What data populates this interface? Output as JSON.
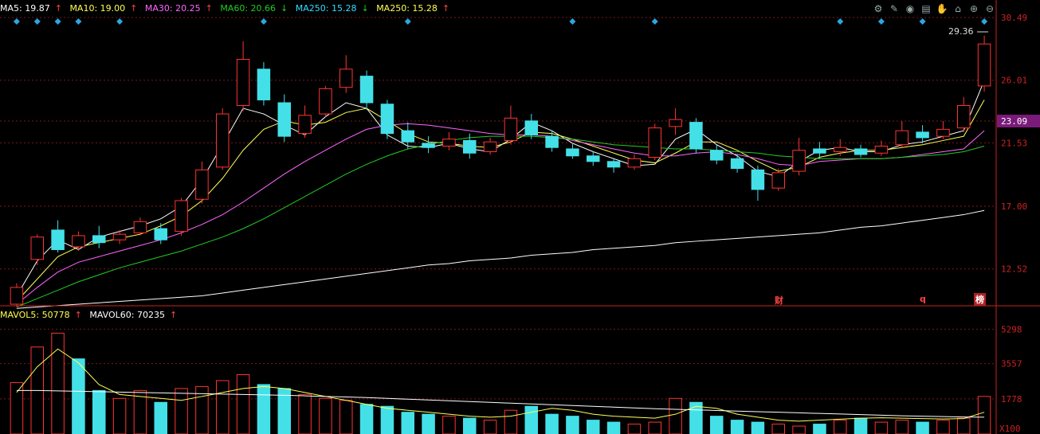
{
  "ma_legend": {
    "ma5": {
      "label": "MA5: 19.87",
      "arrow": "↑",
      "color": "#ffffff"
    },
    "ma10": {
      "label": "MA10: 19.00",
      "arrow": "↑",
      "color": "#ffff55"
    },
    "ma30": {
      "label": "MA30: 20.25",
      "arrow": "↑",
      "color": "#ff66ff"
    },
    "ma60": {
      "label": "MA60: 20.66",
      "arrow": "↓",
      "color": "#22cc22"
    },
    "ma250a": {
      "label": "MA250: 15.28",
      "arrow": "↓",
      "color": "#33ddff"
    },
    "ma250b": {
      "label": "MA250: 15.28",
      "arrow": "↑",
      "color": "#ffff55"
    }
  },
  "vol_legend": {
    "mavol5": {
      "label": "MAVOL5: 50778",
      "arrow": "↑",
      "color": "#ffff55"
    },
    "mavol60": {
      "label": "MAVOL60: 70235",
      "arrow": "↑",
      "color": "#ffffff"
    }
  },
  "toolbar": [
    "gear-icon",
    "draw-icon",
    "eye-icon",
    "print-icon",
    "hand-icon",
    "lock-icon",
    "zoom-in-icon",
    "zoom-out-icon"
  ],
  "price_axis_labels": [
    "30.49",
    "26.01",
    "23.09",
    "21.53",
    "17.00",
    "12.52"
  ],
  "volume_axis_labels": [
    "5298",
    "3557",
    "1778",
    "X100"
  ],
  "highlight_price": "23.09",
  "last_price_tag": "29.36",
  "markers": {
    "cai": "财",
    "q": "q",
    "bang": "榜"
  },
  "colors": {
    "up": "#ff3333",
    "down": "#44e0e8",
    "grid": "#7a1a1a",
    "axis": "#cc2222"
  },
  "chart_data": [
    {
      "type": "candlestick",
      "title": "",
      "ylim": [
        10.0,
        30.49
      ],
      "y_ticks": [
        30.49,
        26.01,
        23.09,
        21.53,
        17.0,
        12.52
      ],
      "series": [
        {
          "name": "MA5",
          "values": [
            10.6,
            13.1,
            14.6,
            13.9,
            14.8,
            15.2,
            15.6,
            16.1,
            17.0,
            18.9,
            21.4,
            24.0,
            23.6,
            22.8,
            22.1,
            23.4,
            24.4,
            24.0,
            22.1,
            21.3,
            21.2,
            21.5,
            21.1,
            20.9,
            21.8,
            23.0,
            22.4,
            21.5,
            20.9,
            20.4,
            19.9,
            20.0,
            21.8,
            22.5,
            21.4,
            20.6,
            19.5,
            19.1,
            20.2,
            21.0,
            21.2,
            20.9,
            20.9,
            21.4,
            21.6,
            22.0,
            22.4,
            26.0
          ]
        },
        {
          "name": "MA10",
          "values": [
            10.2,
            11.8,
            13.4,
            14.1,
            14.4,
            14.7,
            15.0,
            15.6,
            16.3,
            17.4,
            19.0,
            21.0,
            22.5,
            23.1,
            22.8,
            23.0,
            23.7,
            24.0,
            23.1,
            22.2,
            21.6,
            21.5,
            21.3,
            21.2,
            21.6,
            22.3,
            22.2,
            21.8,
            21.3,
            20.8,
            20.3,
            20.1,
            20.8,
            21.6,
            21.6,
            21.0,
            20.2,
            19.5,
            19.8,
            20.5,
            20.8,
            21.0,
            21.0,
            21.2,
            21.4,
            21.7,
            22.0,
            24.6
          ]
        },
        {
          "name": "MA30",
          "values": [
            10.0,
            11.2,
            12.3,
            13.0,
            13.4,
            13.8,
            14.2,
            14.6,
            15.1,
            15.7,
            16.4,
            17.3,
            18.3,
            19.3,
            20.2,
            21.0,
            21.8,
            22.5,
            22.8,
            22.9,
            22.8,
            22.6,
            22.4,
            22.2,
            22.1,
            22.1,
            22.0,
            21.7,
            21.4,
            21.1,
            20.8,
            20.6,
            20.6,
            20.8,
            20.9,
            20.7,
            20.4,
            20.0,
            19.9,
            20.2,
            20.3,
            20.4,
            20.4,
            20.5,
            20.7,
            20.9,
            21.1,
            22.4
          ]
        },
        {
          "name": "MA60",
          "values": [
            9.8,
            10.4,
            11.0,
            11.6,
            12.1,
            12.6,
            13.0,
            13.4,
            13.8,
            14.3,
            14.8,
            15.4,
            16.1,
            16.9,
            17.7,
            18.5,
            19.3,
            20.0,
            20.6,
            21.1,
            21.4,
            21.7,
            21.9,
            22.0,
            22.0,
            22.0,
            21.9,
            21.8,
            21.6,
            21.4,
            21.3,
            21.2,
            21.1,
            21.1,
            21.0,
            20.9,
            20.8,
            20.6,
            20.5,
            20.4,
            20.4,
            20.4,
            20.4,
            20.5,
            20.6,
            20.7,
            20.9,
            21.3
          ]
        },
        {
          "name": "MA250",
          "values": [
            9.7,
            9.8,
            9.9,
            10.0,
            10.1,
            10.2,
            10.3,
            10.4,
            10.5,
            10.6,
            10.8,
            11.0,
            11.2,
            11.4,
            11.6,
            11.8,
            12.0,
            12.2,
            12.4,
            12.6,
            12.8,
            12.9,
            13.1,
            13.2,
            13.3,
            13.5,
            13.6,
            13.7,
            13.9,
            14.0,
            14.1,
            14.2,
            14.4,
            14.5,
            14.6,
            14.7,
            14.8,
            14.9,
            15.0,
            15.1,
            15.3,
            15.5,
            15.6,
            15.8,
            16.0,
            16.2,
            16.4,
            16.7
          ]
        }
      ],
      "candles": [
        [
          10.0,
          11.2,
          9.8,
          11.5
        ],
        [
          13.2,
          14.8,
          12.8,
          15.0
        ],
        [
          15.3,
          13.9,
          13.7,
          16.0
        ],
        [
          14.1,
          14.9,
          13.8,
          15.2
        ],
        [
          14.9,
          14.4,
          14.0,
          15.6
        ],
        [
          14.6,
          15.0,
          14.3,
          15.3
        ],
        [
          15.1,
          15.9,
          14.9,
          16.2
        ],
        [
          15.4,
          14.6,
          14.3,
          15.8
        ],
        [
          15.2,
          17.4,
          14.9,
          17.6
        ],
        [
          17.5,
          19.6,
          17.2,
          20.2
        ],
        [
          19.8,
          23.6,
          19.6,
          24.0
        ],
        [
          24.2,
          27.5,
          23.8,
          28.8
        ],
        [
          26.8,
          24.6,
          24.2,
          27.3
        ],
        [
          24.4,
          22.0,
          21.6,
          25.0
        ],
        [
          22.2,
          23.5,
          21.9,
          24.2
        ],
        [
          23.6,
          25.4,
          23.4,
          25.6
        ],
        [
          25.5,
          26.8,
          25.1,
          27.8
        ],
        [
          26.3,
          24.4,
          23.9,
          26.7
        ],
        [
          24.3,
          22.2,
          21.8,
          24.6
        ],
        [
          22.4,
          21.6,
          21.1,
          23.0
        ],
        [
          21.5,
          21.2,
          20.8,
          22.0
        ],
        [
          21.3,
          21.8,
          21.0,
          22.3
        ],
        [
          21.7,
          20.8,
          20.4,
          22.2
        ],
        [
          20.9,
          21.6,
          20.7,
          21.9
        ],
        [
          21.7,
          23.3,
          21.4,
          24.2
        ],
        [
          23.1,
          22.1,
          21.8,
          23.6
        ],
        [
          22.0,
          21.2,
          20.9,
          22.4
        ],
        [
          21.1,
          20.6,
          20.4,
          21.5
        ],
        [
          20.6,
          20.2,
          19.9,
          20.9
        ],
        [
          20.2,
          19.8,
          19.4,
          20.4
        ],
        [
          19.8,
          20.4,
          19.6,
          20.7
        ],
        [
          20.5,
          22.6,
          20.3,
          22.9
        ],
        [
          22.7,
          23.2,
          22.1,
          24.0
        ],
        [
          23.0,
          21.1,
          20.8,
          23.3
        ],
        [
          21.0,
          20.3,
          20.0,
          21.4
        ],
        [
          20.4,
          19.7,
          19.4,
          20.7
        ],
        [
          19.6,
          18.2,
          17.4,
          19.9
        ],
        [
          18.3,
          19.4,
          18.1,
          19.7
        ],
        [
          19.5,
          21.0,
          19.2,
          21.9
        ],
        [
          21.1,
          20.8,
          20.4,
          21.6
        ],
        [
          20.9,
          21.2,
          20.6,
          21.8
        ],
        [
          21.1,
          20.7,
          20.5,
          21.4
        ],
        [
          20.8,
          21.3,
          20.6,
          21.7
        ],
        [
          21.4,
          22.4,
          21.2,
          23.1
        ],
        [
          22.3,
          21.9,
          21.5,
          22.8
        ],
        [
          22.0,
          22.5,
          21.8,
          23.1
        ],
        [
          22.6,
          24.2,
          22.3,
          24.8
        ],
        [
          25.6,
          28.6,
          25.2,
          29.2
        ]
      ]
    },
    {
      "type": "bar",
      "title": "",
      "ylim": [
        0,
        6000
      ],
      "y_ticks": [
        5298,
        3557,
        1778
      ],
      "series": [
        {
          "name": "MAVOL5",
          "values": [
            2100,
            3400,
            4300,
            3600,
            2500,
            2000,
            1900,
            1800,
            1700,
            1900,
            2100,
            2300,
            2400,
            2300,
            2100,
            1900,
            1700,
            1500,
            1300,
            1200,
            1100,
            1000,
            900,
            850,
            900,
            1100,
            1300,
            1200,
            1000,
            900,
            850,
            800,
            1000,
            1400,
            1300,
            1000,
            850,
            700,
            650,
            700,
            750,
            800,
            820,
            800,
            780,
            760,
            780,
            1100
          ]
        },
        {
          "name": "MAVOL60",
          "values": [
            2200,
            2200,
            2180,
            2160,
            2140,
            2120,
            2100,
            2080,
            2060,
            2040,
            2020,
            2000,
            1980,
            1960,
            1930,
            1900,
            1870,
            1840,
            1800,
            1760,
            1720,
            1680,
            1640,
            1600,
            1560,
            1520,
            1480,
            1440,
            1400,
            1360,
            1320,
            1280,
            1250,
            1220,
            1190,
            1160,
            1130,
            1100,
            1070,
            1040,
            1010,
            980,
            950,
            920,
            900,
            880,
            860,
            850
          ]
        }
      ],
      "values": [
        2600,
        4400,
        5100,
        3800,
        2200,
        1800,
        2200,
        1600,
        2300,
        2400,
        2700,
        3000,
        2500,
        2300,
        2000,
        1800,
        1700,
        1500,
        1400,
        1100,
        1000,
        900,
        800,
        700,
        1200,
        1400,
        1000,
        900,
        700,
        600,
        500,
        600,
        1800,
        1600,
        900,
        700,
        600,
        500,
        400,
        500,
        700,
        800,
        600,
        700,
        600,
        700,
        800,
        1900
      ],
      "up": [
        true,
        true,
        true,
        false,
        false,
        true,
        true,
        false,
        true,
        true,
        true,
        true,
        false,
        false,
        true,
        true,
        true,
        false,
        false,
        false,
        false,
        true,
        false,
        true,
        true,
        false,
        false,
        false,
        false,
        false,
        true,
        true,
        true,
        false,
        false,
        false,
        false,
        true,
        true,
        false,
        true,
        false,
        true,
        true,
        false,
        true,
        true,
        true
      ]
    }
  ]
}
